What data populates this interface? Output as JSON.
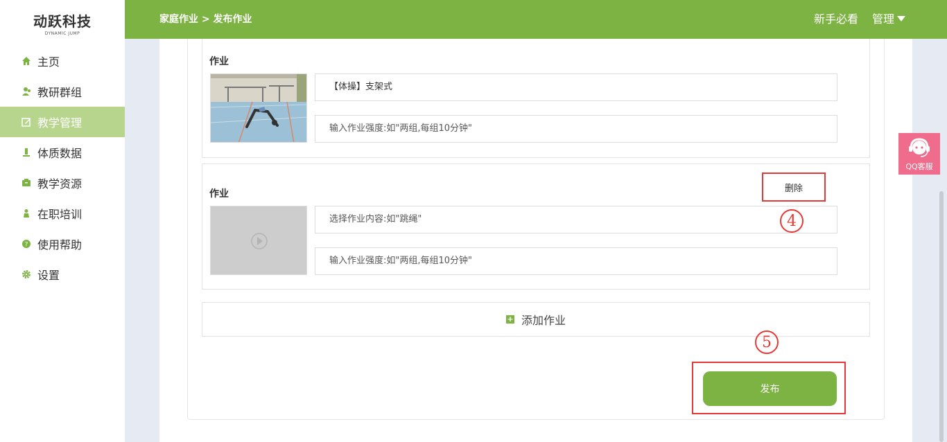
{
  "logo": {
    "main": "动跃科技",
    "sub": "DYNAMIC JUMP"
  },
  "sidebar": {
    "items": [
      {
        "label": "主页",
        "icon": "home-icon"
      },
      {
        "label": "教研群组",
        "icon": "users-icon"
      },
      {
        "label": "教学管理",
        "icon": "edit-icon",
        "active": true
      },
      {
        "label": "体质数据",
        "icon": "data-icon"
      },
      {
        "label": "教学资源",
        "icon": "resource-icon"
      },
      {
        "label": "在职培训",
        "icon": "training-icon"
      },
      {
        "label": "使用帮助",
        "icon": "help-icon"
      },
      {
        "label": "设置",
        "icon": "gear-icon"
      }
    ]
  },
  "header": {
    "breadcrumb": "家庭作业 > 发布作业",
    "guide": "新手必看",
    "manage": "管理"
  },
  "homework": [
    {
      "label": "作业",
      "content": "【体操】支架式",
      "intensity_placeholder": "输入作业强度:如\"两组,每组10分钟\""
    },
    {
      "label": "作业",
      "content_placeholder": "选择作业内容:如\"跳绳\"",
      "intensity_placeholder": "输入作业强度:如\"两组,每组10分钟\"",
      "delete_label": "删除"
    }
  ],
  "annotations": {
    "step4": "4",
    "step5": "5"
  },
  "add_homework_label": "添加作业",
  "publish_label": "发布",
  "qq_service_label": "QQ客服",
  "colors": {
    "primary": "#7cb342",
    "active_nav": "#b7d58c",
    "annotation": "#e53935",
    "qq": "#f06c8d"
  }
}
